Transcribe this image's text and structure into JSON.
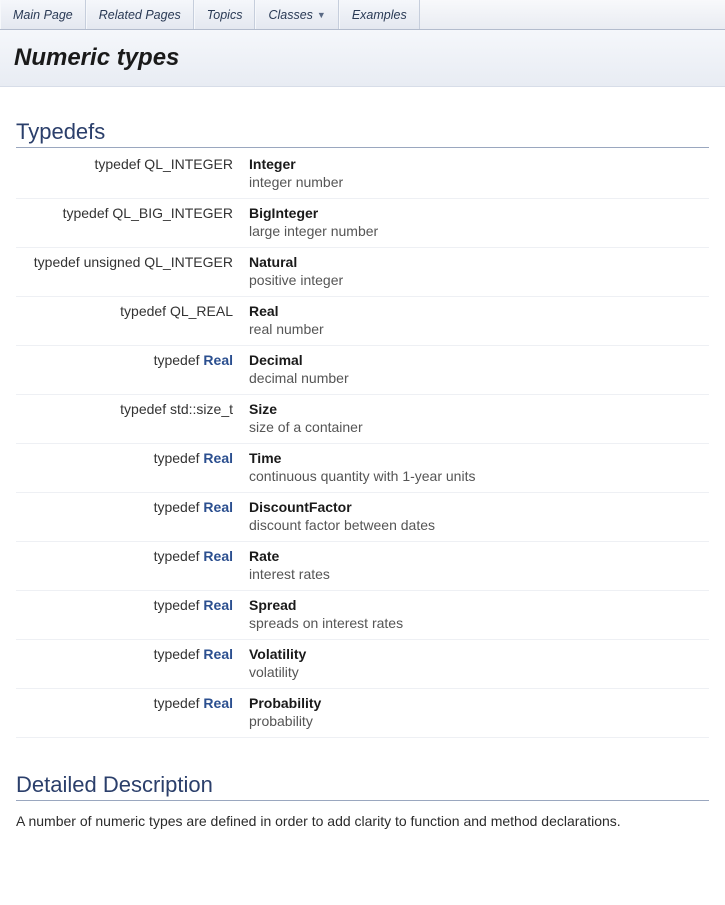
{
  "tabs": {
    "main_page": "Main Page",
    "related_pages": "Related Pages",
    "topics": "Topics",
    "classes": "Classes",
    "examples": "Examples"
  },
  "page_title": "Numeric types",
  "sections": {
    "typedefs_heading": "Typedefs",
    "detailed_heading": "Detailed Description",
    "detailed_text": "A number of numeric types are defined in order to add clarity to function and method declarations."
  },
  "typedefs": [
    {
      "left_prefix": "typedef QL_INTEGER",
      "left_link": "",
      "name": "Integer",
      "desc": "integer number"
    },
    {
      "left_prefix": "typedef QL_BIG_INTEGER",
      "left_link": "",
      "name": "BigInteger",
      "desc": "large integer number"
    },
    {
      "left_prefix": "typedef unsigned QL_INTEGER",
      "left_link": "",
      "name": "Natural",
      "desc": "positive integer"
    },
    {
      "left_prefix": "typedef QL_REAL",
      "left_link": "",
      "name": "Real",
      "desc": "real number"
    },
    {
      "left_prefix": "typedef ",
      "left_link": "Real",
      "name": "Decimal",
      "desc": "decimal number"
    },
    {
      "left_prefix": "typedef std::size_t",
      "left_link": "",
      "name": "Size",
      "desc": "size of a container"
    },
    {
      "left_prefix": "typedef ",
      "left_link": "Real",
      "name": "Time",
      "desc": "continuous quantity with 1-year units"
    },
    {
      "left_prefix": "typedef ",
      "left_link": "Real",
      "name": "DiscountFactor",
      "desc": "discount factor between dates"
    },
    {
      "left_prefix": "typedef ",
      "left_link": "Real",
      "name": "Rate",
      "desc": "interest rates"
    },
    {
      "left_prefix": "typedef ",
      "left_link": "Real",
      "name": "Spread",
      "desc": "spreads on interest rates"
    },
    {
      "left_prefix": "typedef ",
      "left_link": "Real",
      "name": "Volatility",
      "desc": "volatility"
    },
    {
      "left_prefix": "typedef ",
      "left_link": "Real",
      "name": "Probability",
      "desc": "probability"
    }
  ]
}
